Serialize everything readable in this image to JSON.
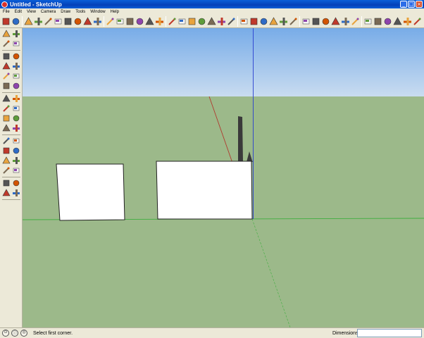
{
  "window": {
    "title": "Untitled - SketchUp",
    "minimize_glyph": "_",
    "maximize_glyph": "□",
    "close_glyph": "×"
  },
  "menubar": {
    "items": [
      "File",
      "Edit",
      "View",
      "Camera",
      "Draw",
      "Tools",
      "Window",
      "Help"
    ]
  },
  "toolbar": {
    "tools": [
      "select",
      "line",
      "rectangle",
      "circle",
      "arc",
      "eraser",
      "paint-bucket",
      "push-pull",
      "move",
      "rotate",
      "offset",
      "tape-measure",
      "dimension",
      "protractor",
      "text",
      "axes",
      "orbit",
      "pan",
      "zoom",
      "zoom-window",
      "zoom-extents",
      "previous",
      "next",
      "walk",
      "look-around",
      "position-camera",
      "components",
      "materials",
      "layers",
      "iso",
      "top",
      "front",
      "right",
      "back",
      "left",
      "xray",
      "wireframe",
      "hidden-line",
      "shaded",
      "shaded-textures",
      "monochrome"
    ]
  },
  "left_toolbar": {
    "tools": [
      "select",
      "make-component",
      "paint-bucket",
      "eraser",
      "rectangle",
      "line",
      "circle",
      "arc",
      "polygon",
      "freehand",
      "move",
      "push-pull",
      "rotate",
      "follow-me",
      "scale",
      "offset",
      "tape-measure",
      "dimension",
      "protractor",
      "text",
      "axes",
      "3d-text",
      "orbit",
      "pan",
      "zoom",
      "zoom-window",
      "previous",
      "zoom-extents",
      "position-camera",
      "look-around",
      "walk",
      "section-plane"
    ]
  },
  "colors": {
    "sky_top": "#78ACE8",
    "sky_bottom": "#C9DCF0",
    "ground": "#9CB98A",
    "red_axis": "#B03A2E",
    "green_axis": "#3FAE3F",
    "blue_axis": "#2A3FD0",
    "face": "#FFFFFF",
    "edge": "#222222",
    "figure": "#3A3A3A"
  },
  "status": {
    "icon_1": "⊙",
    "icon_2": "ⓘ",
    "icon_3": "◎",
    "message": "Select first corner.",
    "dimensions_label": "Dimensions",
    "dimensions_value": ""
  }
}
